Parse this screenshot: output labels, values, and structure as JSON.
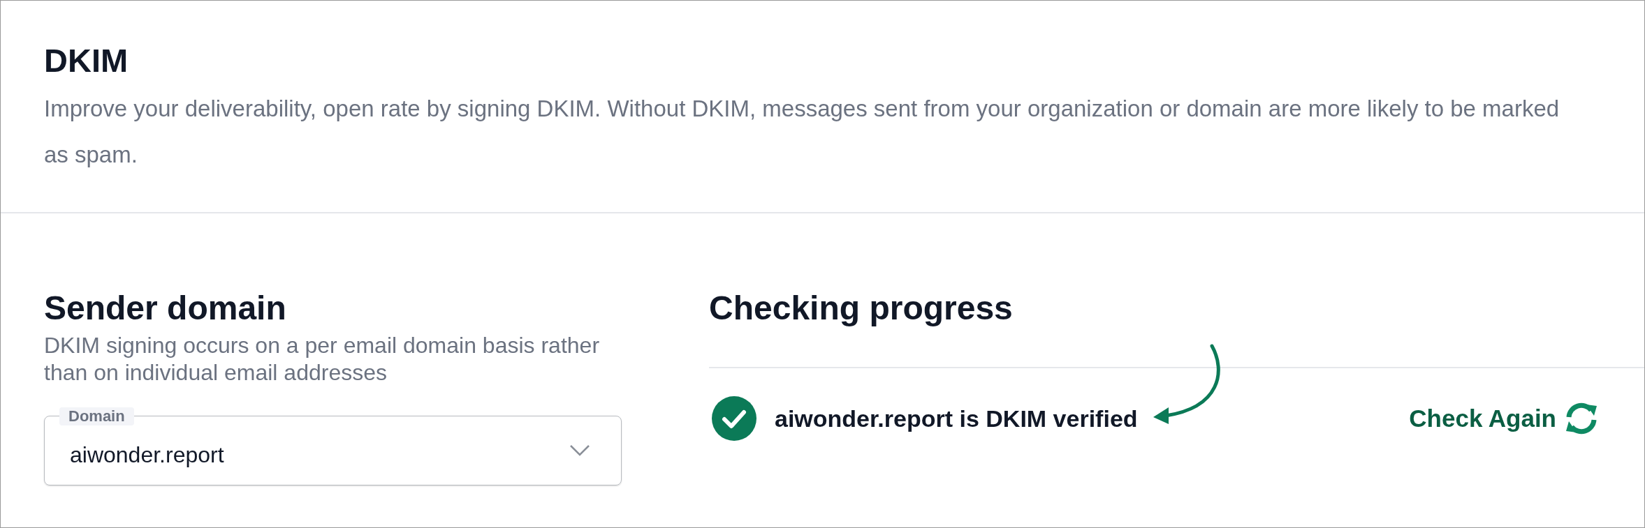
{
  "header": {
    "title": "DKIM",
    "description": "Improve your deliverability, open rate by signing DKIM. Without DKIM, messages sent from your organization or domain are more likely to be marked as spam."
  },
  "sender_domain": {
    "title": "Sender domain",
    "description": "DKIM signing occurs on a per email domain basis rather than on individual email addresses",
    "field": {
      "label": "Domain",
      "value": "aiwonder.report"
    }
  },
  "checking_progress": {
    "title": "Checking progress",
    "status": {
      "text": "aiwonder.report is DKIM verified",
      "verified": true
    },
    "action": "Check Again"
  }
}
